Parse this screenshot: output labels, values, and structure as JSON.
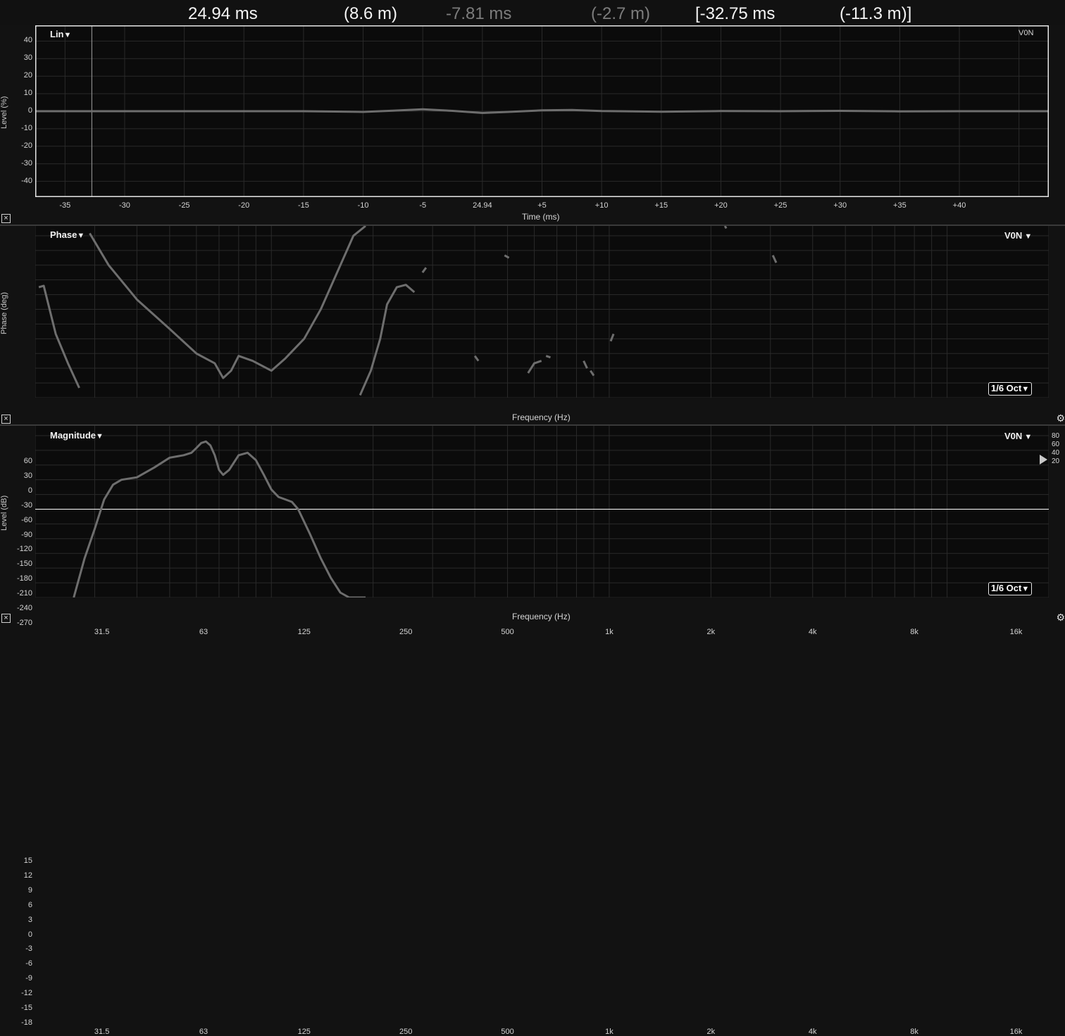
{
  "readout": {
    "delay": "24.94 ms",
    "distance": "(8.6 m)",
    "delay_b": "-7.81 ms",
    "distance_b": "(-2.7 m)",
    "delay_c": "[-32.75 ms",
    "distance_c": "(-11.3 m)]"
  },
  "impulse": {
    "mode": "Lin",
    "trace_name": "V0N",
    "ylabel": "Level (%)",
    "xlabel": "Time (ms)",
    "yticks": [
      "40",
      "30",
      "20",
      "10",
      "0",
      "-10",
      "-20",
      "-30",
      "-40"
    ],
    "xticks": [
      "-35",
      "-30",
      "-25",
      "-20",
      "-15",
      "-10",
      "-5",
      "24.94",
      "+5",
      "+10",
      "+15",
      "+20",
      "+25",
      "+30",
      "+35",
      "+40"
    ]
  },
  "phase": {
    "title": "Phase",
    "trace_name": "V0N",
    "ylabel": "Phase (deg)",
    "xlabel": "Frequency (Hz)",
    "smoothing": "1/6 Oct",
    "yticks": [
      "60",
      "30",
      "0",
      "-30",
      "-60",
      "-90",
      "-120",
      "-150",
      "-180",
      "-210",
      "-240",
      "-270"
    ],
    "xticks": [
      "31.5",
      "63",
      "125",
      "250",
      "500",
      "1k",
      "2k",
      "4k",
      "8k",
      "16k"
    ]
  },
  "magnitude": {
    "title": "Magnitude",
    "trace_name": "V0N",
    "ylabel": "Level (dB)",
    "xlabel": "Frequency (Hz)",
    "smoothing": "1/6 Oct",
    "yticks": [
      "15",
      "12",
      "9",
      "6",
      "3",
      "0",
      "-3",
      "-6",
      "-9",
      "-12",
      "-15",
      "-18"
    ],
    "xticks": [
      "31.5",
      "63",
      "125",
      "250",
      "500",
      "1k",
      "2k",
      "4k",
      "8k",
      "16k"
    ],
    "coherence_scale": [
      "80",
      "60",
      "40",
      "20"
    ]
  },
  "icons": {
    "close": "close-icon",
    "settings": "gear-icon",
    "dropdown": "triangle-down-icon"
  },
  "colors": {
    "trace": "#6e6e6e",
    "grid": "#2a2a2a",
    "background": "#0b0b0b",
    "zero_line": "#ffffff"
  },
  "chart_data": [
    {
      "type": "line",
      "title": "Lin",
      "xlabel": "Time (ms)",
      "ylabel": "Level (%)",
      "xlim": [
        -37.5,
        47.5
      ],
      "ylim": [
        -49,
        49
      ],
      "cursor_x": -32.75,
      "series": [
        {
          "name": "V0N",
          "x": [
            -37.5,
            -25,
            -15,
            -10,
            -7.5,
            -5,
            -2.5,
            0,
            2.5,
            5,
            7.5,
            10,
            15,
            20,
            25,
            30,
            35,
            40,
            45,
            47.5
          ],
          "y": [
            0,
            0,
            0,
            -0.4,
            0.3,
            1.1,
            0.2,
            -1.0,
            -0.3,
            0.5,
            0.7,
            0.1,
            -0.3,
            0.1,
            0,
            0.2,
            -0.1,
            0,
            0,
            0
          ]
        }
      ]
    },
    {
      "type": "line",
      "title": "Phase",
      "xlabel": "Frequency (Hz)",
      "ylabel": "Phase (deg)",
      "x_scale": "log",
      "xlim": [
        20,
        20000
      ],
      "ylim": [
        -270,
        80
      ],
      "series": [
        {
          "name": "V0N",
          "segments": [
            [
              [
                20.5,
                -45
              ],
              [
                21.2,
                -42
              ],
              [
                23,
                -140
              ],
              [
                25,
                -200
              ],
              [
                27,
                -250
              ]
            ],
            [
              [
                29,
                65
              ],
              [
                33,
                0
              ],
              [
                40,
                -70
              ],
              [
                50,
                -130
              ],
              [
                60,
                -180
              ],
              [
                68,
                -200
              ],
              [
                72,
                -230
              ],
              [
                76,
                -215
              ],
              [
                80,
                -185
              ],
              [
                88,
                -195
              ],
              [
                100,
                -215
              ],
              [
                110,
                -190
              ],
              [
                125,
                -150
              ],
              [
                140,
                -90
              ],
              [
                160,
                0
              ],
              [
                175,
                60
              ],
              [
                190,
                80
              ]
            ],
            [
              [
                183,
                -265
              ],
              [
                197,
                -215
              ],
              [
                210,
                -150
              ],
              [
                220,
                -80
              ],
              [
                235,
                -45
              ],
              [
                250,
                -40
              ],
              [
                265,
                -55
              ]
            ],
            [
              [
                280,
                -15
              ],
              [
                287,
                -5
              ]
            ],
            [
              [
                490,
                20
              ],
              [
                505,
                15
              ]
            ],
            [
              [
                400,
                -185
              ],
              [
                410,
                -195
              ]
            ],
            [
              [
                575,
                -220
              ],
              [
                600,
                -200
              ],
              [
                630,
                -195
              ]
            ],
            [
              [
                650,
                -185
              ],
              [
                670,
                -188
              ]
            ],
            [
              [
                840,
                -195
              ],
              [
                860,
                -210
              ]
            ],
            [
              [
                880,
                -215
              ],
              [
                900,
                -225
              ]
            ],
            [
              [
                1010,
                -155
              ],
              [
                1030,
                -140
              ]
            ],
            [
              [
                2200,
                80
              ],
              [
                2220,
                75
              ]
            ],
            [
              [
                3050,
                20
              ],
              [
                3120,
                5
              ]
            ]
          ]
        }
      ]
    },
    {
      "type": "line",
      "title": "Magnitude",
      "xlabel": "Frequency (Hz)",
      "ylabel": "Level (dB)",
      "x_scale": "log",
      "xlim": [
        20,
        20000
      ],
      "ylim": [
        -18,
        17
      ],
      "series": [
        {
          "name": "V0N",
          "x": [
            26,
            28,
            30,
            32,
            34,
            36,
            40,
            45,
            50,
            55,
            58,
            60,
            62,
            64,
            66,
            68,
            70,
            72,
            75,
            80,
            85,
            90,
            95,
            100,
            105,
            110,
            115,
            120,
            130,
            140,
            150,
            160,
            170,
            180,
            190
          ],
          "y": [
            -18,
            -10,
            -4,
            2,
            5,
            6,
            6.5,
            8.5,
            10.5,
            11,
            11.5,
            12.5,
            13.5,
            13.8,
            13,
            11,
            8,
            7,
            8,
            11,
            11.5,
            10,
            7,
            4,
            2.5,
            2,
            1.5,
            0,
            -5,
            -10,
            -14,
            -17,
            -18,
            -18,
            -18
          ]
        }
      ]
    }
  ]
}
